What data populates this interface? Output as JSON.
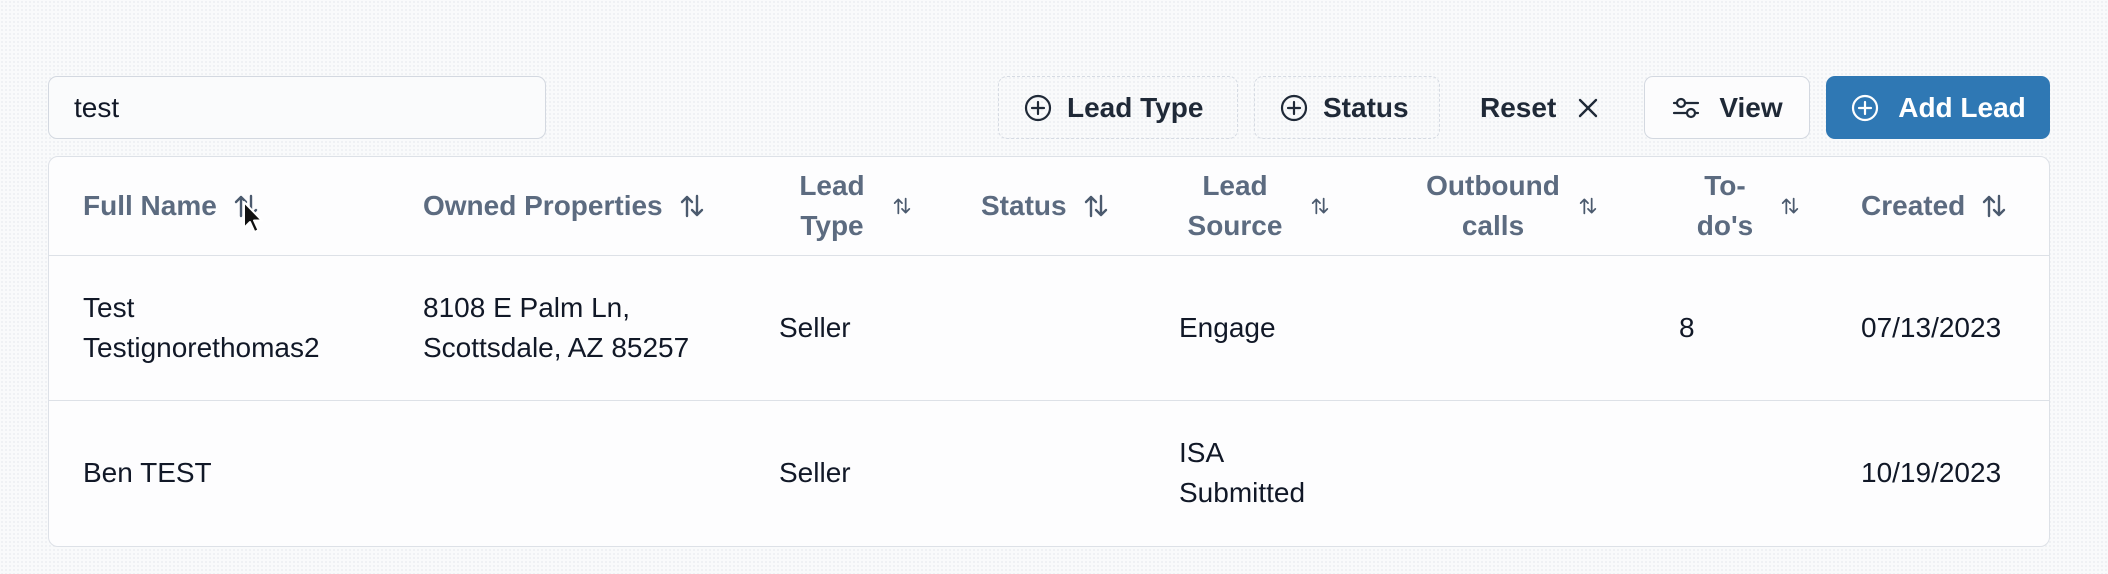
{
  "search": {
    "value": "test",
    "placeholder": ""
  },
  "filters": {
    "lead_type_label": "Lead Type",
    "status_label": "Status",
    "reset_label": "Reset",
    "view_label": "View",
    "add_label": "Add Lead"
  },
  "table": {
    "columns": [
      {
        "label": "Full Name"
      },
      {
        "label": "Owned Properties"
      },
      {
        "label": "Lead Type"
      },
      {
        "label": "Status"
      },
      {
        "label": "Lead Source"
      },
      {
        "label": "Outbound calls"
      },
      {
        "label": "To-do's"
      },
      {
        "label": "Created"
      }
    ],
    "rows": [
      {
        "full_name": "Test Testignorethomas2",
        "owned_properties": "8108 E Palm Ln, Scottsdale, AZ 85257",
        "lead_type": "Seller",
        "status": "",
        "lead_source": "Engage",
        "outbound_calls": "",
        "todos": "8",
        "created": "07/13/2023"
      },
      {
        "full_name": "Ben TEST",
        "owned_properties": "",
        "lead_type": "Seller",
        "status": "",
        "lead_source": "ISA Submitted",
        "outbound_calls": "",
        "todos": "",
        "created": "10/19/2023"
      }
    ]
  },
  "colors": {
    "accent": "#2f78b4",
    "header_text": "#5c6b80",
    "border": "#dde1e7"
  },
  "icons": [
    "plus-circle-icon",
    "close-icon",
    "sliders-icon",
    "sort-icon",
    "mouse-cursor-icon"
  ]
}
